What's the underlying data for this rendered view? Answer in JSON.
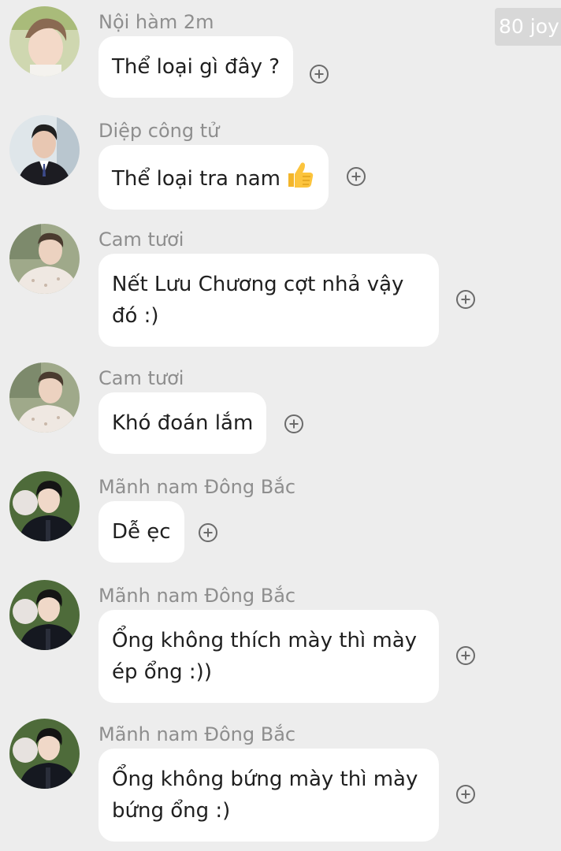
{
  "badge": {
    "label": "80 joy"
  },
  "messages": [
    {
      "sender": "Nội hàm 2m",
      "text": "Thể loại gì đây ?",
      "avatar": "avatar-light-hair",
      "emoji": ""
    },
    {
      "sender": "Diệp công tử",
      "text": "Thể loại tra nam",
      "avatar": "avatar-suit",
      "emoji": "thumbs-up"
    },
    {
      "sender": "Cam tươi",
      "text": "Nết Lưu Chương cợt nhả vậy đó :)",
      "avatar": "avatar-sweater",
      "emoji": ""
    },
    {
      "sender": "Cam tươi",
      "text": "Khó đoán lắm",
      "avatar": "avatar-sweater",
      "emoji": ""
    },
    {
      "sender": "Mãnh nam Đông Bắc",
      "text": "Dễ ẹc",
      "avatar": "avatar-dark-jacket",
      "emoji": ""
    },
    {
      "sender": "Mãnh nam Đông Bắc",
      "text": "Ổng không thích mày thì mày ép ổng :))",
      "avatar": "avatar-dark-jacket",
      "emoji": ""
    },
    {
      "sender": "Mãnh nam Đông Bắc",
      "text": "Ổng không bứng mày thì mày bứng ổng :)",
      "avatar": "avatar-dark-jacket",
      "emoji": ""
    }
  ],
  "colors": {
    "background": "#ededed",
    "bubble": "#ffffff",
    "sender_text": "#8e8e8e",
    "message_text": "#1f1f1f",
    "badge_bg": "#d8d8d8"
  }
}
